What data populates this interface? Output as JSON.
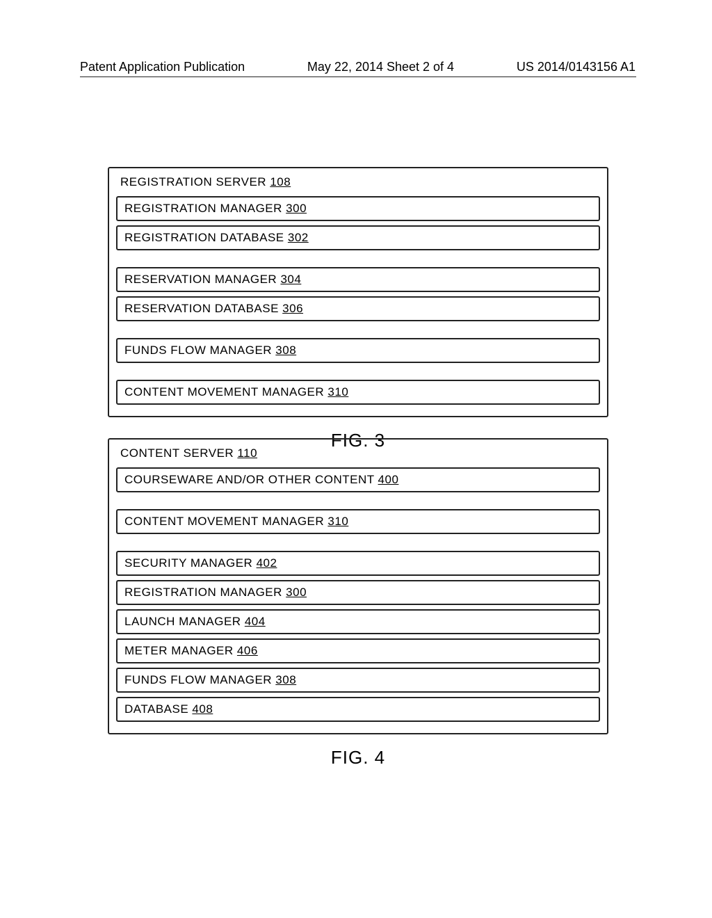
{
  "header": {
    "left": "Patent Application Publication",
    "center": "May 22, 2014  Sheet 2 of 4",
    "right": "US 2014/0143156 A1"
  },
  "fig3": {
    "title_label": "REGISTRATION SERVER",
    "title_ref": "108",
    "rows": [
      {
        "label": "REGISTRATION MANAGER",
        "ref": "300"
      },
      {
        "label": "REGISTRATION DATABASE",
        "ref": "302"
      },
      {
        "gap": true
      },
      {
        "label": "RESERVATION MANAGER",
        "ref": "304"
      },
      {
        "label": "RESERVATION DATABASE",
        "ref": "306"
      },
      {
        "gap": true
      },
      {
        "label": "FUNDS FLOW MANAGER",
        "ref": "308"
      },
      {
        "gap": true
      },
      {
        "label": "CONTENT MOVEMENT MANAGER",
        "ref": "310"
      }
    ],
    "caption": "FIG. 3"
  },
  "fig4": {
    "title_label": "CONTENT SERVER",
    "title_ref": "110",
    "rows": [
      {
        "label": "COURSEWARE AND/OR OTHER CONTENT",
        "ref": "400"
      },
      {
        "gap": true
      },
      {
        "label": "CONTENT MOVEMENT MANAGER",
        "ref": "310"
      },
      {
        "gap": true
      },
      {
        "label": "SECURITY MANAGER",
        "ref": "402"
      },
      {
        "label": "REGISTRATION MANAGER",
        "ref": "300"
      },
      {
        "label": "LAUNCH MANAGER",
        "ref": "404"
      },
      {
        "label": "METER MANAGER",
        "ref": "406"
      },
      {
        "label": "FUNDS FLOW MANAGER",
        "ref": "308"
      },
      {
        "label": "DATABASE",
        "ref": "408"
      }
    ],
    "caption": "FIG. 4"
  }
}
